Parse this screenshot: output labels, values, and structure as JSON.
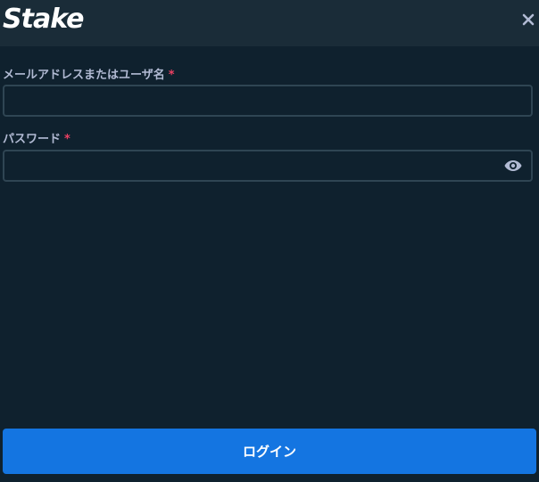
{
  "header": {
    "logo_text": "Stake",
    "close_icon": "close-icon"
  },
  "form": {
    "email": {
      "label": "メールアドレスまたはユーザ名",
      "required_mark": "*",
      "value": "",
      "placeholder": ""
    },
    "password": {
      "label": "パスワード",
      "required_mark": "*",
      "value": "",
      "placeholder": "",
      "toggle_icon": "eye-icon"
    }
  },
  "actions": {
    "login_label": "ログイン"
  },
  "colors": {
    "background": "#0f212e",
    "header_background": "#1a2c38",
    "input_border": "#2f4553",
    "label_text": "#b1bad3",
    "required_mark": "#ed4163",
    "login_button": "#1475e1"
  }
}
